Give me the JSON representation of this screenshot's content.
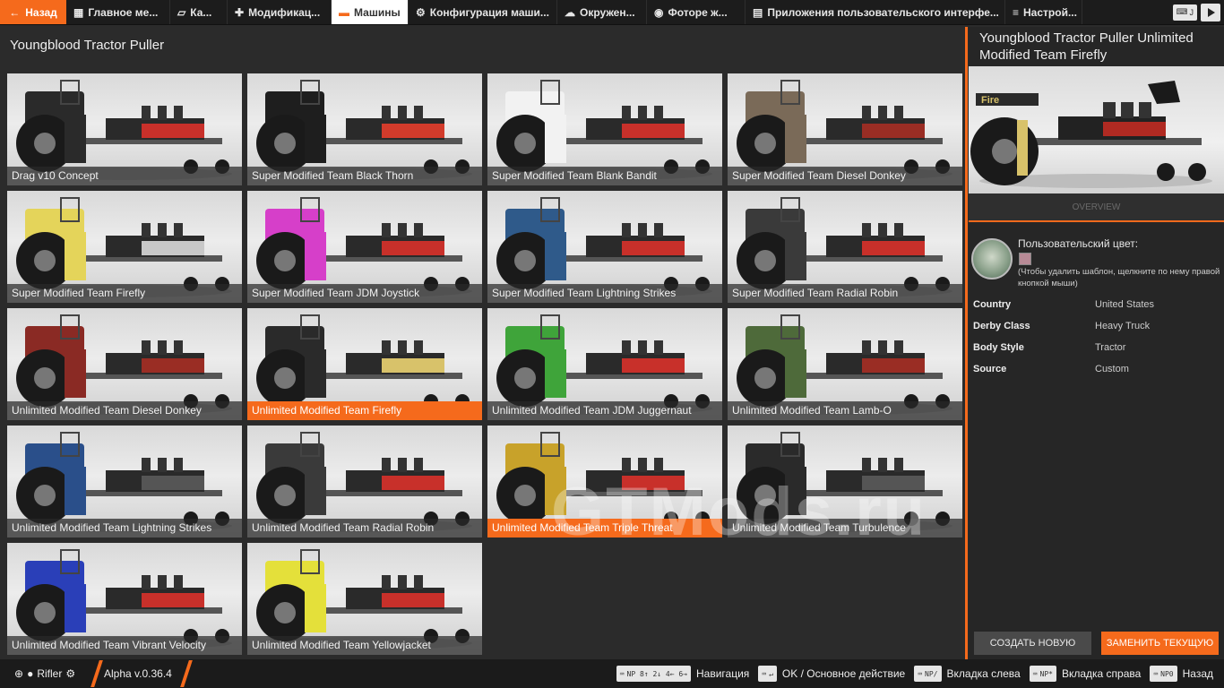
{
  "topbar": {
    "back_label": "Назад",
    "tabs": [
      {
        "label": "Главное ме...",
        "icon": "grid-icon"
      },
      {
        "label": "Ка...",
        "icon": "map-icon"
      },
      {
        "label": "Модификац...",
        "icon": "puzzle-icon"
      },
      {
        "label": "Машины",
        "icon": "car-icon",
        "active": true
      },
      {
        "label": "Конфигурация маши...",
        "icon": "engine-icon"
      },
      {
        "label": "Окружен...",
        "icon": "weather-icon"
      },
      {
        "label": "Фоторе ж...",
        "icon": "camera-icon"
      },
      {
        "label": "Приложения пользовательского интерфе...",
        "icon": "window-icon"
      },
      {
        "label": "Настрой...",
        "icon": "sliders-icon"
      }
    ],
    "kbd_label": "J"
  },
  "page_title": "Youngblood Tractor Puller",
  "vehicles": [
    {
      "name": "Drag v10 Concept",
      "color": "#2a2a2a",
      "accent": "#c8302a"
    },
    {
      "name": "Super Modified Team Black Thorn",
      "color": "#1e1e1e",
      "accent": "#d23b2b"
    },
    {
      "name": "Super Modified Team Blank Bandit",
      "color": "#f2f2f2",
      "accent": "#c8302a"
    },
    {
      "name": "Super Modified Team Diesel Donkey",
      "color": "#7a6a58",
      "accent": "#9a2d24"
    },
    {
      "name": "Super Modified Team Firefly",
      "color": "#e4d45a",
      "accent": "#c8c8c8"
    },
    {
      "name": "Super Modified Team JDM Joystick",
      "color": "#d63fc9",
      "accent": "#c8302a"
    },
    {
      "name": "Super Modified Team Lightning Strikes",
      "color": "#2f5a8a",
      "accent": "#c8302a"
    },
    {
      "name": "Super Modified Team Radial Robin",
      "color": "#3a3a3a",
      "accent": "#c8302a"
    },
    {
      "name": "Unlimited Modified Team Diesel Donkey",
      "color": "#8a2a24",
      "accent": "#9a2d24"
    },
    {
      "name": "Unlimited Modified Team Firefly",
      "color": "#2a2a2a",
      "accent": "#d8c26a",
      "selected": true
    },
    {
      "name": "Unlimited Modified Team JDM Juggernaut",
      "color": "#3fa43a",
      "accent": "#c8302a"
    },
    {
      "name": "Unlimited Modified Team Lamb-O",
      "color": "#4e6a3a",
      "accent": "#9a2d24"
    },
    {
      "name": "Unlimited Modified Team Lightning Strikes",
      "color": "#2a4f8a",
      "accent": "#555"
    },
    {
      "name": "Unlimited Modified Team Radial Robin",
      "color": "#3a3a3a",
      "accent": "#c8302a"
    },
    {
      "name": "Unlimited Modified Team Triple Threat",
      "color": "#c8a22a",
      "accent": "#c8302a",
      "selected": true
    },
    {
      "name": "Unlimited Modified Team Turbulence",
      "color": "#2a2a2a",
      "accent": "#555"
    },
    {
      "name": "Unlimited Modified Team Vibrant Velocity",
      "color": "#2a3fb8",
      "accent": "#c8302a"
    },
    {
      "name": "Unlimited Modified Team Yellowjacket",
      "color": "#e4e03a",
      "accent": "#c8302a"
    }
  ],
  "watermark": "GTMods.ru",
  "detail": {
    "title": "Youngblood Tractor Puller Unlimited Modified Team Firefly",
    "overview_label": "OVERVIEW",
    "custom_color_label": "Пользовательский цвет:",
    "custom_color_hint": "(Чтобы удалить шаблон, щелкните по нему правой кнопкой мыши)",
    "props": [
      {
        "key": "Country",
        "value": "United States"
      },
      {
        "key": "Derby Class",
        "value": "Heavy Truck"
      },
      {
        "key": "Body Style",
        "value": "Tractor"
      },
      {
        "key": "Source",
        "value": "Custom"
      }
    ],
    "btn_new": "СОЗДАТЬ НОВУЮ",
    "btn_replace": "ЗАМЕНИТЬ ТЕКУЩУЮ"
  },
  "bottombar": {
    "user": "Rifler",
    "version": "Alpha v.0.36.4",
    "hints": [
      {
        "keys": "NP 8↑ 2↓ 4← 6→",
        "label": "Навигация"
      },
      {
        "keys": "↵",
        "label": "OK / Основное действие"
      },
      {
        "keys": "NP/",
        "label": "Вкладка слева"
      },
      {
        "keys": "NP*",
        "label": "Вкладка справа"
      },
      {
        "keys": "NP0",
        "label": "Назад"
      }
    ]
  }
}
